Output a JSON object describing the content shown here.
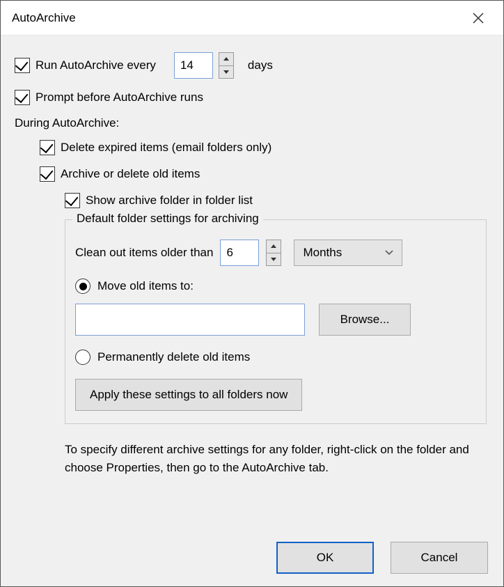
{
  "title": "AutoArchive",
  "run_every": {
    "label_prefix": "Run AutoArchive every",
    "value": "14",
    "label_suffix": "days",
    "checked": true
  },
  "prompt": {
    "label": "Prompt before AutoArchive runs",
    "checked": true
  },
  "during_label": "During AutoArchive:",
  "delete_expired": {
    "label": "Delete expired items (email folders only)",
    "checked": true
  },
  "archive_delete": {
    "label": "Archive or delete old items",
    "checked": true
  },
  "show_folder": {
    "label": "Show archive folder in folder list",
    "checked": true
  },
  "fieldset": {
    "legend": "Default folder settings for archiving",
    "clean_label": "Clean out items older than",
    "clean_value": "6",
    "unit_selected": "Months",
    "move_radio": {
      "label": "Move old items to:",
      "checked": true
    },
    "path_value": "",
    "browse_label": "Browse...",
    "delete_radio": {
      "label": "Permanently delete old items",
      "checked": false
    },
    "apply_label": "Apply these settings to all folders now"
  },
  "help_text": "To specify different archive settings for any folder, right-click on the folder and choose Properties, then go to the AutoArchive tab.",
  "ok_label": "OK",
  "cancel_label": "Cancel"
}
